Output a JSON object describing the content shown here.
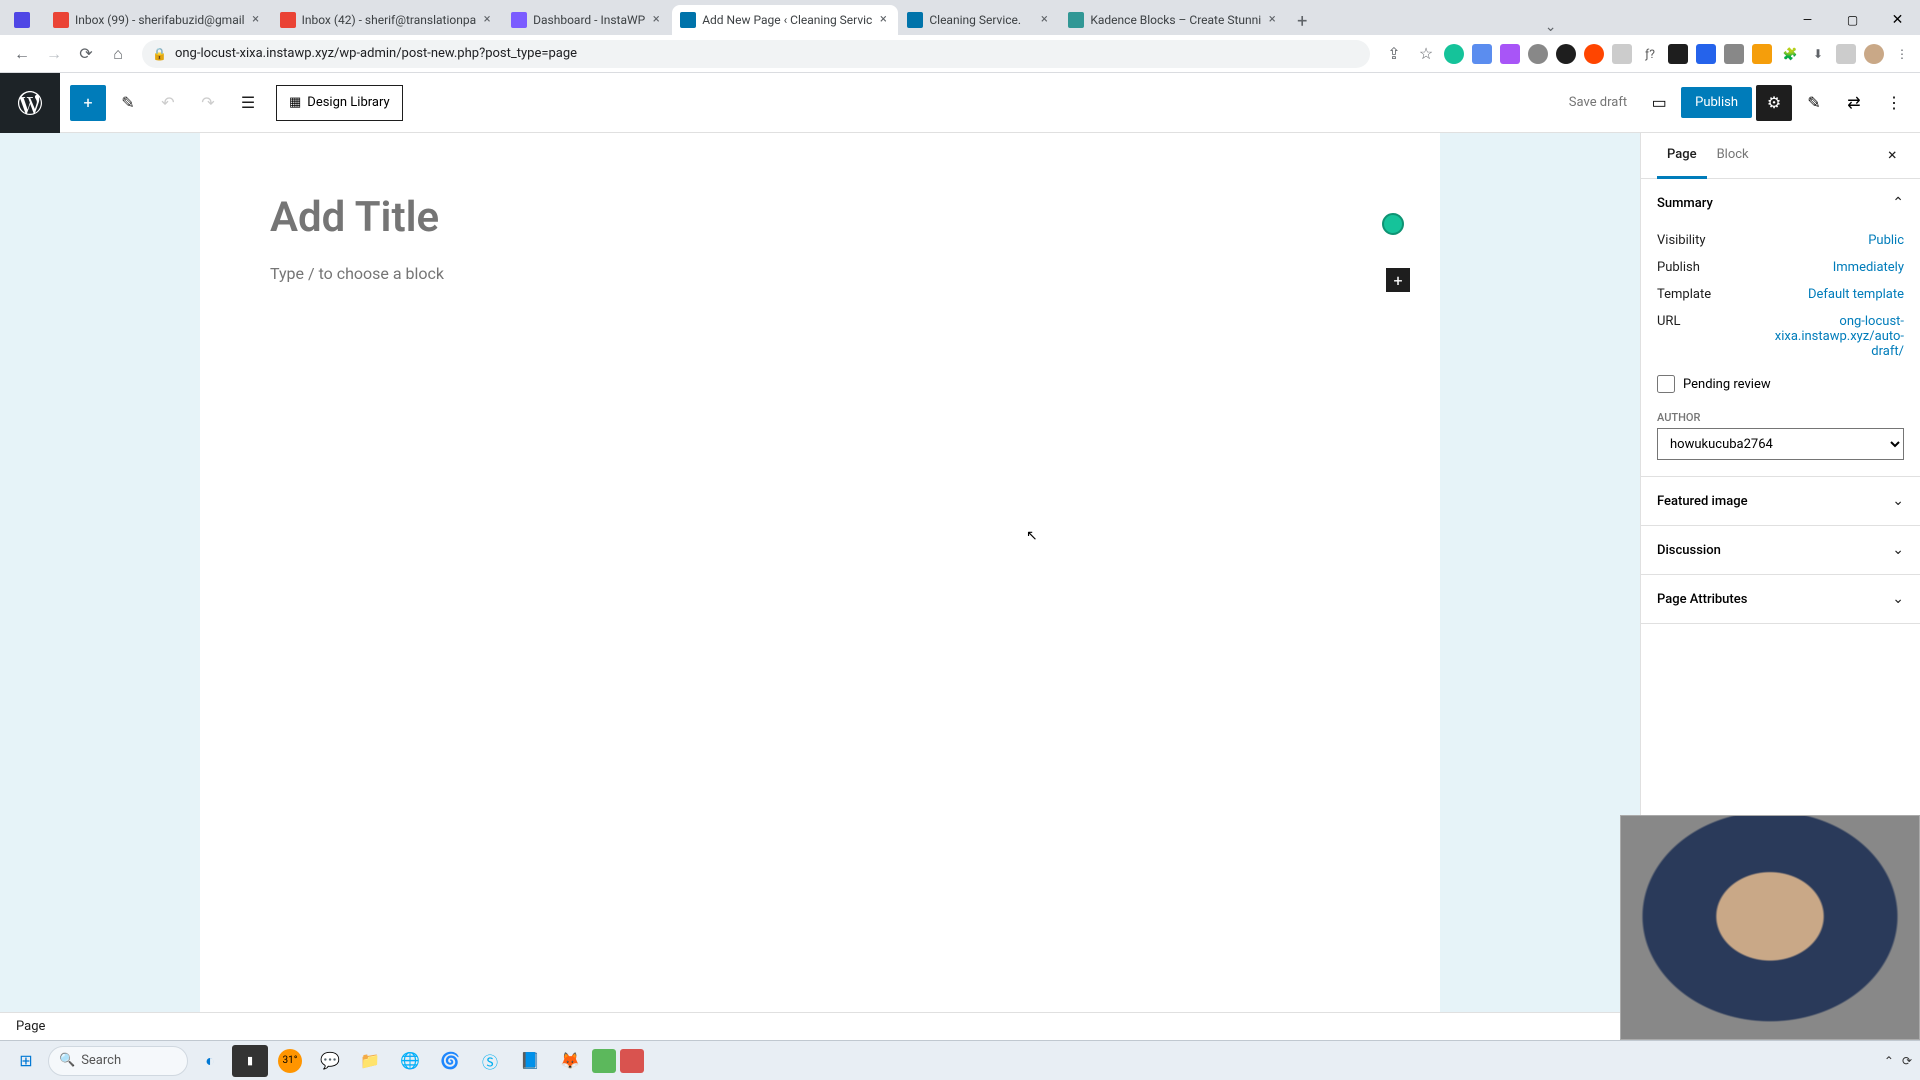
{
  "browser": {
    "tabs": [
      {
        "title": "",
        "favicon_color": "#4f46e5"
      },
      {
        "title": "Inbox (99) - sherifabuzid@gmail",
        "favicon_color": "#ea4335"
      },
      {
        "title": "Inbox (42) - sherif@translationpa",
        "favicon_color": "#ea4335"
      },
      {
        "title": "Dashboard - InstaWP",
        "favicon_color": "#7b5cff"
      },
      {
        "title": "Add New Page ‹ Cleaning Servic",
        "favicon_color": "#0073aa",
        "active": true
      },
      {
        "title": "Cleaning Service.",
        "favicon_color": "#0073aa"
      },
      {
        "title": "Kadence Blocks – Create Stunni",
        "favicon_color": "#319795"
      }
    ],
    "url": "ong-locust-xixa.instawp.xyz/wp-admin/post-new.php?post_type=page"
  },
  "editor": {
    "design_library": "Design Library",
    "save_draft": "Save draft",
    "publish": "Publish",
    "title_placeholder": "Add Title",
    "block_prompt": "Type / to choose a block",
    "breadcrumb": "Page"
  },
  "sidebar": {
    "tab_page": "Page",
    "tab_block": "Block",
    "summary": {
      "title": "Summary",
      "visibility_label": "Visibility",
      "visibility_value": "Public",
      "publish_label": "Publish",
      "publish_value": "Immediately",
      "template_label": "Template",
      "template_value": "Default template",
      "url_label": "URL",
      "url_value": "ong-locust-xixa.instawp.xyz/auto-draft/",
      "pending_review": "Pending review",
      "author_label": "AUTHOR",
      "author_value": "howukucuba2764"
    },
    "featured_image": "Featured image",
    "discussion": "Discussion",
    "page_attributes": "Page Attributes"
  },
  "taskbar": {
    "search_placeholder": "Search",
    "temp": "31°"
  }
}
